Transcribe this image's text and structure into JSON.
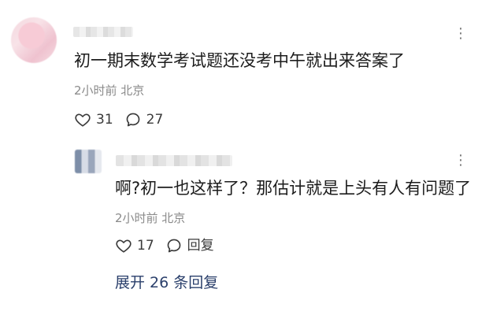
{
  "comment": {
    "text": "初一期末数学考试题还没考中午就出来答案了",
    "meta": "2小时前 北京",
    "likes": "31",
    "replies": "27",
    "more_icon": "more-icon",
    "like_icon": "heart-icon",
    "comment_icon": "comment-bubble-icon"
  },
  "reply": {
    "text": "啊?初一也这样了？那估计就是上头有人有问题了",
    "meta": "2小时前 北京",
    "likes": "17",
    "reply_label": "回复",
    "more_icon": "more-icon",
    "like_icon": "heart-icon",
    "comment_icon": "comment-bubble-icon"
  },
  "expand_label": "展开 26 条回复",
  "colors": {
    "link": "#2a3f6b",
    "meta": "#8a8a8a",
    "text": "#1c1c1c"
  }
}
